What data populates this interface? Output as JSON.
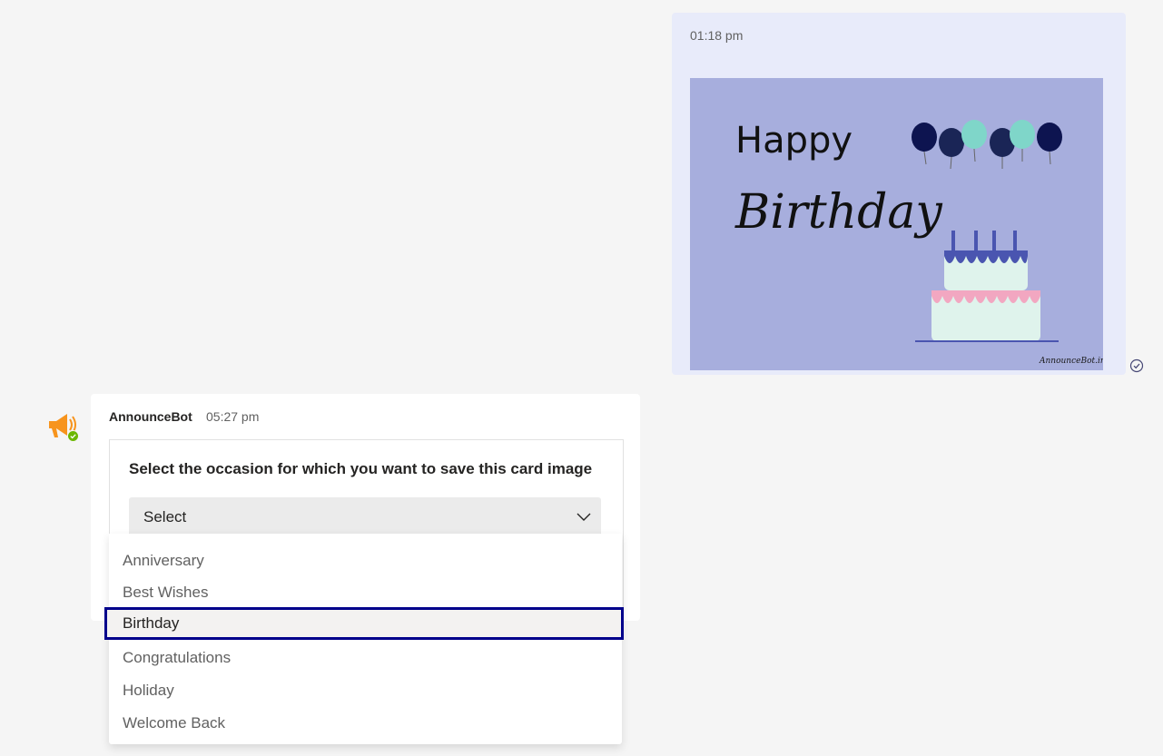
{
  "sent_message": {
    "time": "01:18 pm",
    "card": {
      "line1": "Happy",
      "line2": "Birthday",
      "watermark": "AnnounceBot.in"
    }
  },
  "bot_message": {
    "sender": "AnnounceBot",
    "time": "05:27 pm",
    "prompt": "Select the occasion for which you want to save this card image",
    "select": {
      "value": "Select"
    }
  },
  "dropdown": {
    "options": [
      "Anniversary",
      "Best Wishes",
      "Birthday",
      "Congratulations",
      "Holiday",
      "Welcome Back"
    ],
    "highlighted": "Birthday"
  },
  "colors": {
    "sent_bubble": "#e8ebfa",
    "card_background": "#a7aedd",
    "focus_outline": "#00008b",
    "presence_available": "#6bb700",
    "bot_icon": "#f7941d"
  },
  "icons": {
    "read_receipt": "check-circle-icon",
    "select_chevron": "chevron-down-icon",
    "bot_avatar": "megaphone-icon",
    "presence": "available-status-icon"
  }
}
